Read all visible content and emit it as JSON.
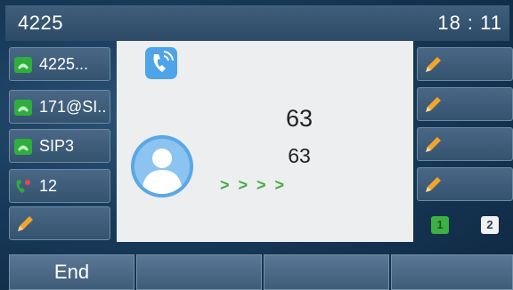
{
  "status_bar": {
    "account": "4225",
    "time": "18 : 11"
  },
  "line_keys": [
    {
      "label": "4225...",
      "icon": "line-registered-icon"
    },
    {
      "label": "171@SI..",
      "icon": "line-registered-icon"
    },
    {
      "label": "SIP3",
      "icon": "line-registered-icon"
    },
    {
      "label": "12",
      "icon": "line-in-use-icon"
    }
  ],
  "call": {
    "name": "63",
    "number": "63",
    "progress": ">  >  >  >"
  },
  "page_indicators": [
    "1",
    "2"
  ],
  "softkeys": {
    "end": "End"
  },
  "colors": {
    "accent_green": "#49a845",
    "line_icon_green": "#2fae3e",
    "pencil_orange": "#f0a52b"
  }
}
